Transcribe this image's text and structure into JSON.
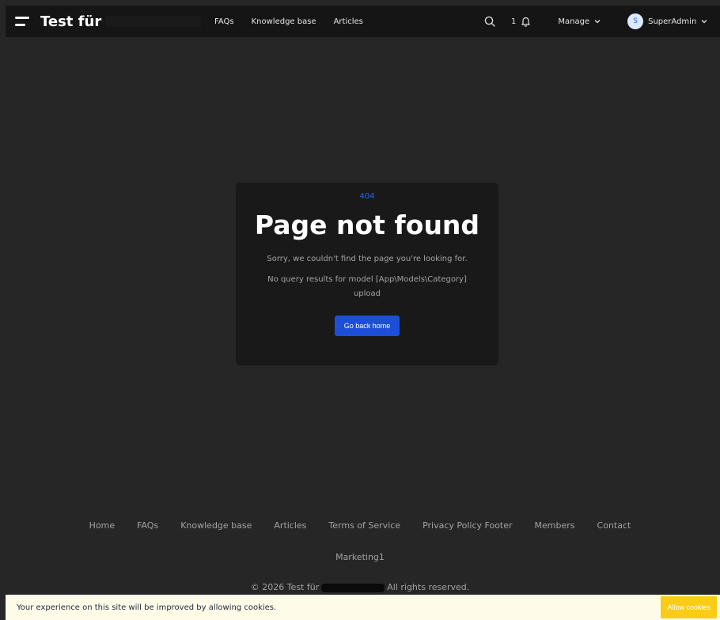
{
  "header": {
    "brand": "Test für",
    "nav": [
      "FAQs",
      "Knowledge base",
      "Articles"
    ],
    "notification_count": "1",
    "manage_label": "Manage",
    "user": {
      "initial": "S",
      "name": "SuperAdmin"
    }
  },
  "error": {
    "code": "404",
    "title": "Page not found",
    "message": "Sorry, we couldn't find the page you're looking for.",
    "detail": "No query results for model [App\\Models\\Category] upload",
    "button_label": "Go back home"
  },
  "footer": {
    "links": [
      "Home",
      "FAQs",
      "Knowledge base",
      "Articles",
      "Terms of Service",
      "Privacy Policy Footer",
      "Members",
      "Contact"
    ],
    "extra_link": "Marketing1",
    "copyright_prefix": "© 2026 Test für",
    "copyright_suffix": "All rights reserved."
  },
  "cookie": {
    "message": "Your experience on this site will be improved by allowing cookies.",
    "button_label": "Allow cookies"
  },
  "colors": {
    "accent": "#1d4ed8",
    "cookie_bg": "#fefce8",
    "cookie_button": "#facc15"
  }
}
